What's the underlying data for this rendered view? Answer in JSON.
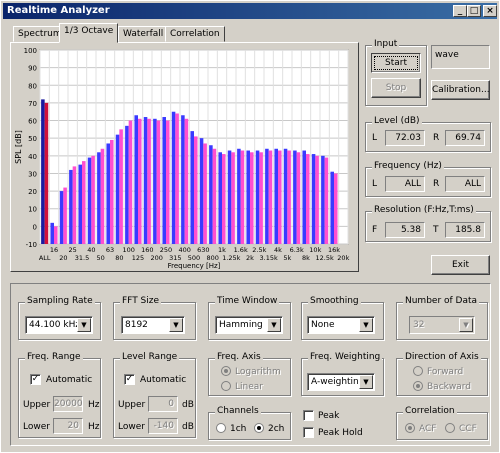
{
  "window": {
    "title": "Realtime Analyzer",
    "buttons": [
      "_",
      "□",
      "×"
    ]
  },
  "tabs": [
    "Spectrum",
    "1/3 Octave",
    "Waterfall",
    "Correlation"
  ],
  "active_tab": "1/3 Octave",
  "chart_data": {
    "type": "bar",
    "ylabel": "SPL [dB]",
    "xlabel": "Frequency [Hz]",
    "ylim": [
      -10,
      100
    ],
    "yticks": [
      100,
      90,
      80,
      70,
      60,
      50,
      40,
      30,
      20,
      10,
      0,
      -10
    ],
    "categories": [
      "ALL",
      "16",
      "20",
      "25",
      "31.5",
      "40",
      "50",
      "63",
      "80",
      "100",
      "125",
      "160",
      "200",
      "250",
      "315",
      "400",
      "500",
      "630",
      "800",
      "1k",
      "1.25k",
      "1.6k",
      "2k",
      "2.5k",
      "3.15k",
      "4k",
      "5k",
      "6.3k",
      "8k",
      "10k",
      "12.5k",
      "16k",
      "20k"
    ],
    "xtick_top": [
      "16",
      "25",
      "40",
      "63",
      "100",
      "160",
      "250",
      "400",
      "630",
      "1k",
      "1.6k",
      "2.5k",
      "4k",
      "6.3k",
      "10k",
      "16k"
    ],
    "xtick_bottom": [
      "ALL",
      "20",
      "31.5",
      "50",
      "80",
      "125",
      "200",
      "315",
      "500",
      "800",
      "1.25k",
      "2k",
      "3.15k",
      "5k",
      "8k",
      "12.5k",
      "20k"
    ],
    "series": [
      {
        "name": "L",
        "color": "#3a3aff",
        "values": [
          72,
          2,
          20,
          32,
          35,
          39,
          42,
          47,
          52,
          57,
          63,
          62,
          61,
          62,
          65,
          63,
          54,
          50,
          46,
          42,
          43,
          44,
          43,
          43,
          44,
          44,
          44,
          43,
          43,
          41,
          40,
          31
        ]
      },
      {
        "name": "R",
        "color": "#ff4fd0",
        "values": [
          70,
          0,
          22,
          34,
          37,
          40,
          44,
          49,
          55,
          60,
          61,
          61,
          60,
          60,
          64,
          61,
          51,
          47,
          44,
          41,
          42,
          43,
          42,
          42,
          43,
          43,
          43,
          42,
          41,
          40,
          39,
          30
        ]
      }
    ]
  },
  "input": {
    "label": "Input",
    "start": "Start",
    "stop": "Stop",
    "source": "wave",
    "calibration": "Calibration..."
  },
  "level": {
    "label": "Level (dB)",
    "l": "L",
    "l_value": "72.03",
    "r": "R",
    "r_value": "69.74"
  },
  "frequency": {
    "label": "Frequency (Hz)",
    "l": "L",
    "l_value": "ALL",
    "r": "R",
    "r_value": "ALL"
  },
  "resolution": {
    "label": "Resolution (F:Hz,T:ms)",
    "f": "F",
    "f_value": "5.38",
    "t": "T",
    "t_value": "185.8"
  },
  "exit": "Exit",
  "sampling_rate": {
    "label": "Sampling Rate",
    "value": "44.100 kHz"
  },
  "fft_size": {
    "label": "FFT Size",
    "value": "8192"
  },
  "time_window": {
    "label": "Time Window",
    "value": "Hamming"
  },
  "smoothing": {
    "label": "Smoothing",
    "value": "None"
  },
  "number_of_data": {
    "label": "Number of Data",
    "value": "32"
  },
  "freq_range": {
    "label": "Freq. Range",
    "automatic": "Automatic",
    "upper": "Upper",
    "upper_value": "20000",
    "lower": "Lower",
    "lower_value": "20",
    "unit": "Hz"
  },
  "level_range": {
    "label": "Level Range",
    "automatic": "Automatic",
    "upper": "Upper",
    "upper_value": "0",
    "lower": "Lower",
    "lower_value": "-140",
    "unit": "dB"
  },
  "freq_axis": {
    "label": "Freq. Axis",
    "logarithm": "Logarithm",
    "linear": "Linear"
  },
  "freq_weighting": {
    "label": "Freq. Weighting",
    "value": "A-weighting"
  },
  "direction": {
    "label": "Direction of Axis",
    "forward": "Forward",
    "backward": "Backward"
  },
  "channels": {
    "label": "Channels",
    "ch1": "1ch",
    "ch2": "2ch"
  },
  "peak": "Peak",
  "peak_hold": "Peak Hold",
  "correlation": {
    "label": "Correlation",
    "acf": "ACF",
    "ccf": "CCF"
  }
}
